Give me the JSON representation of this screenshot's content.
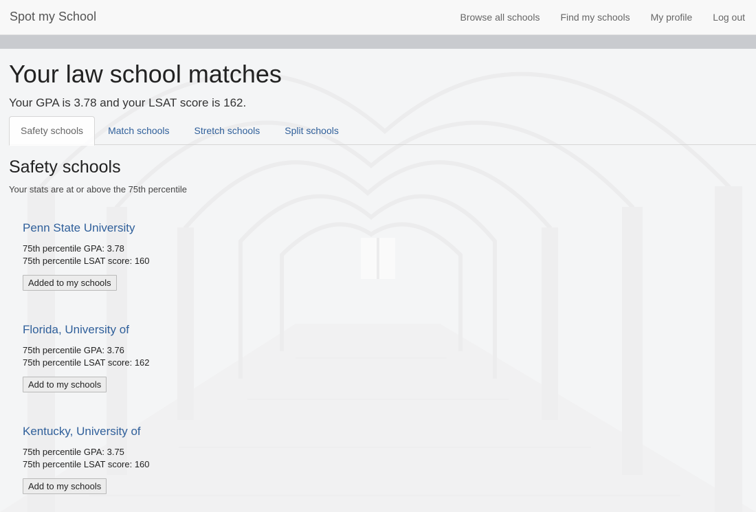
{
  "navbar": {
    "brand": "Spot my School",
    "links": [
      "Browse all schools",
      "Find my schools",
      "My profile",
      "Log out"
    ]
  },
  "page": {
    "title": "Your law school matches",
    "stats_line": "Your GPA is 3.78 and your LSAT score is 162."
  },
  "tabs": [
    "Safety schools",
    "Match schools",
    "Stretch schools",
    "Split schools"
  ],
  "active_tab": "Safety schools",
  "section": {
    "title": "Safety schools",
    "description": "Your stats are at or above the 75th percentile"
  },
  "schools": [
    {
      "name": "Penn State University",
      "gpa": "75th percentile GPA: 3.78",
      "lsat": "75th percentile LSAT score: 160",
      "button": "Added to my schools"
    },
    {
      "name": "Florida, University of",
      "gpa": "75th percentile GPA: 3.76",
      "lsat": "75th percentile LSAT score: 162",
      "button": "Add to my schools"
    },
    {
      "name": "Kentucky, University of",
      "gpa": "75th percentile GPA: 3.75",
      "lsat": "75th percentile LSAT score: 160",
      "button": "Add to my schools"
    }
  ],
  "colors": {
    "link": "#2f5f9a",
    "navbar_bg": "#f8f8f8",
    "text": "#222222"
  }
}
